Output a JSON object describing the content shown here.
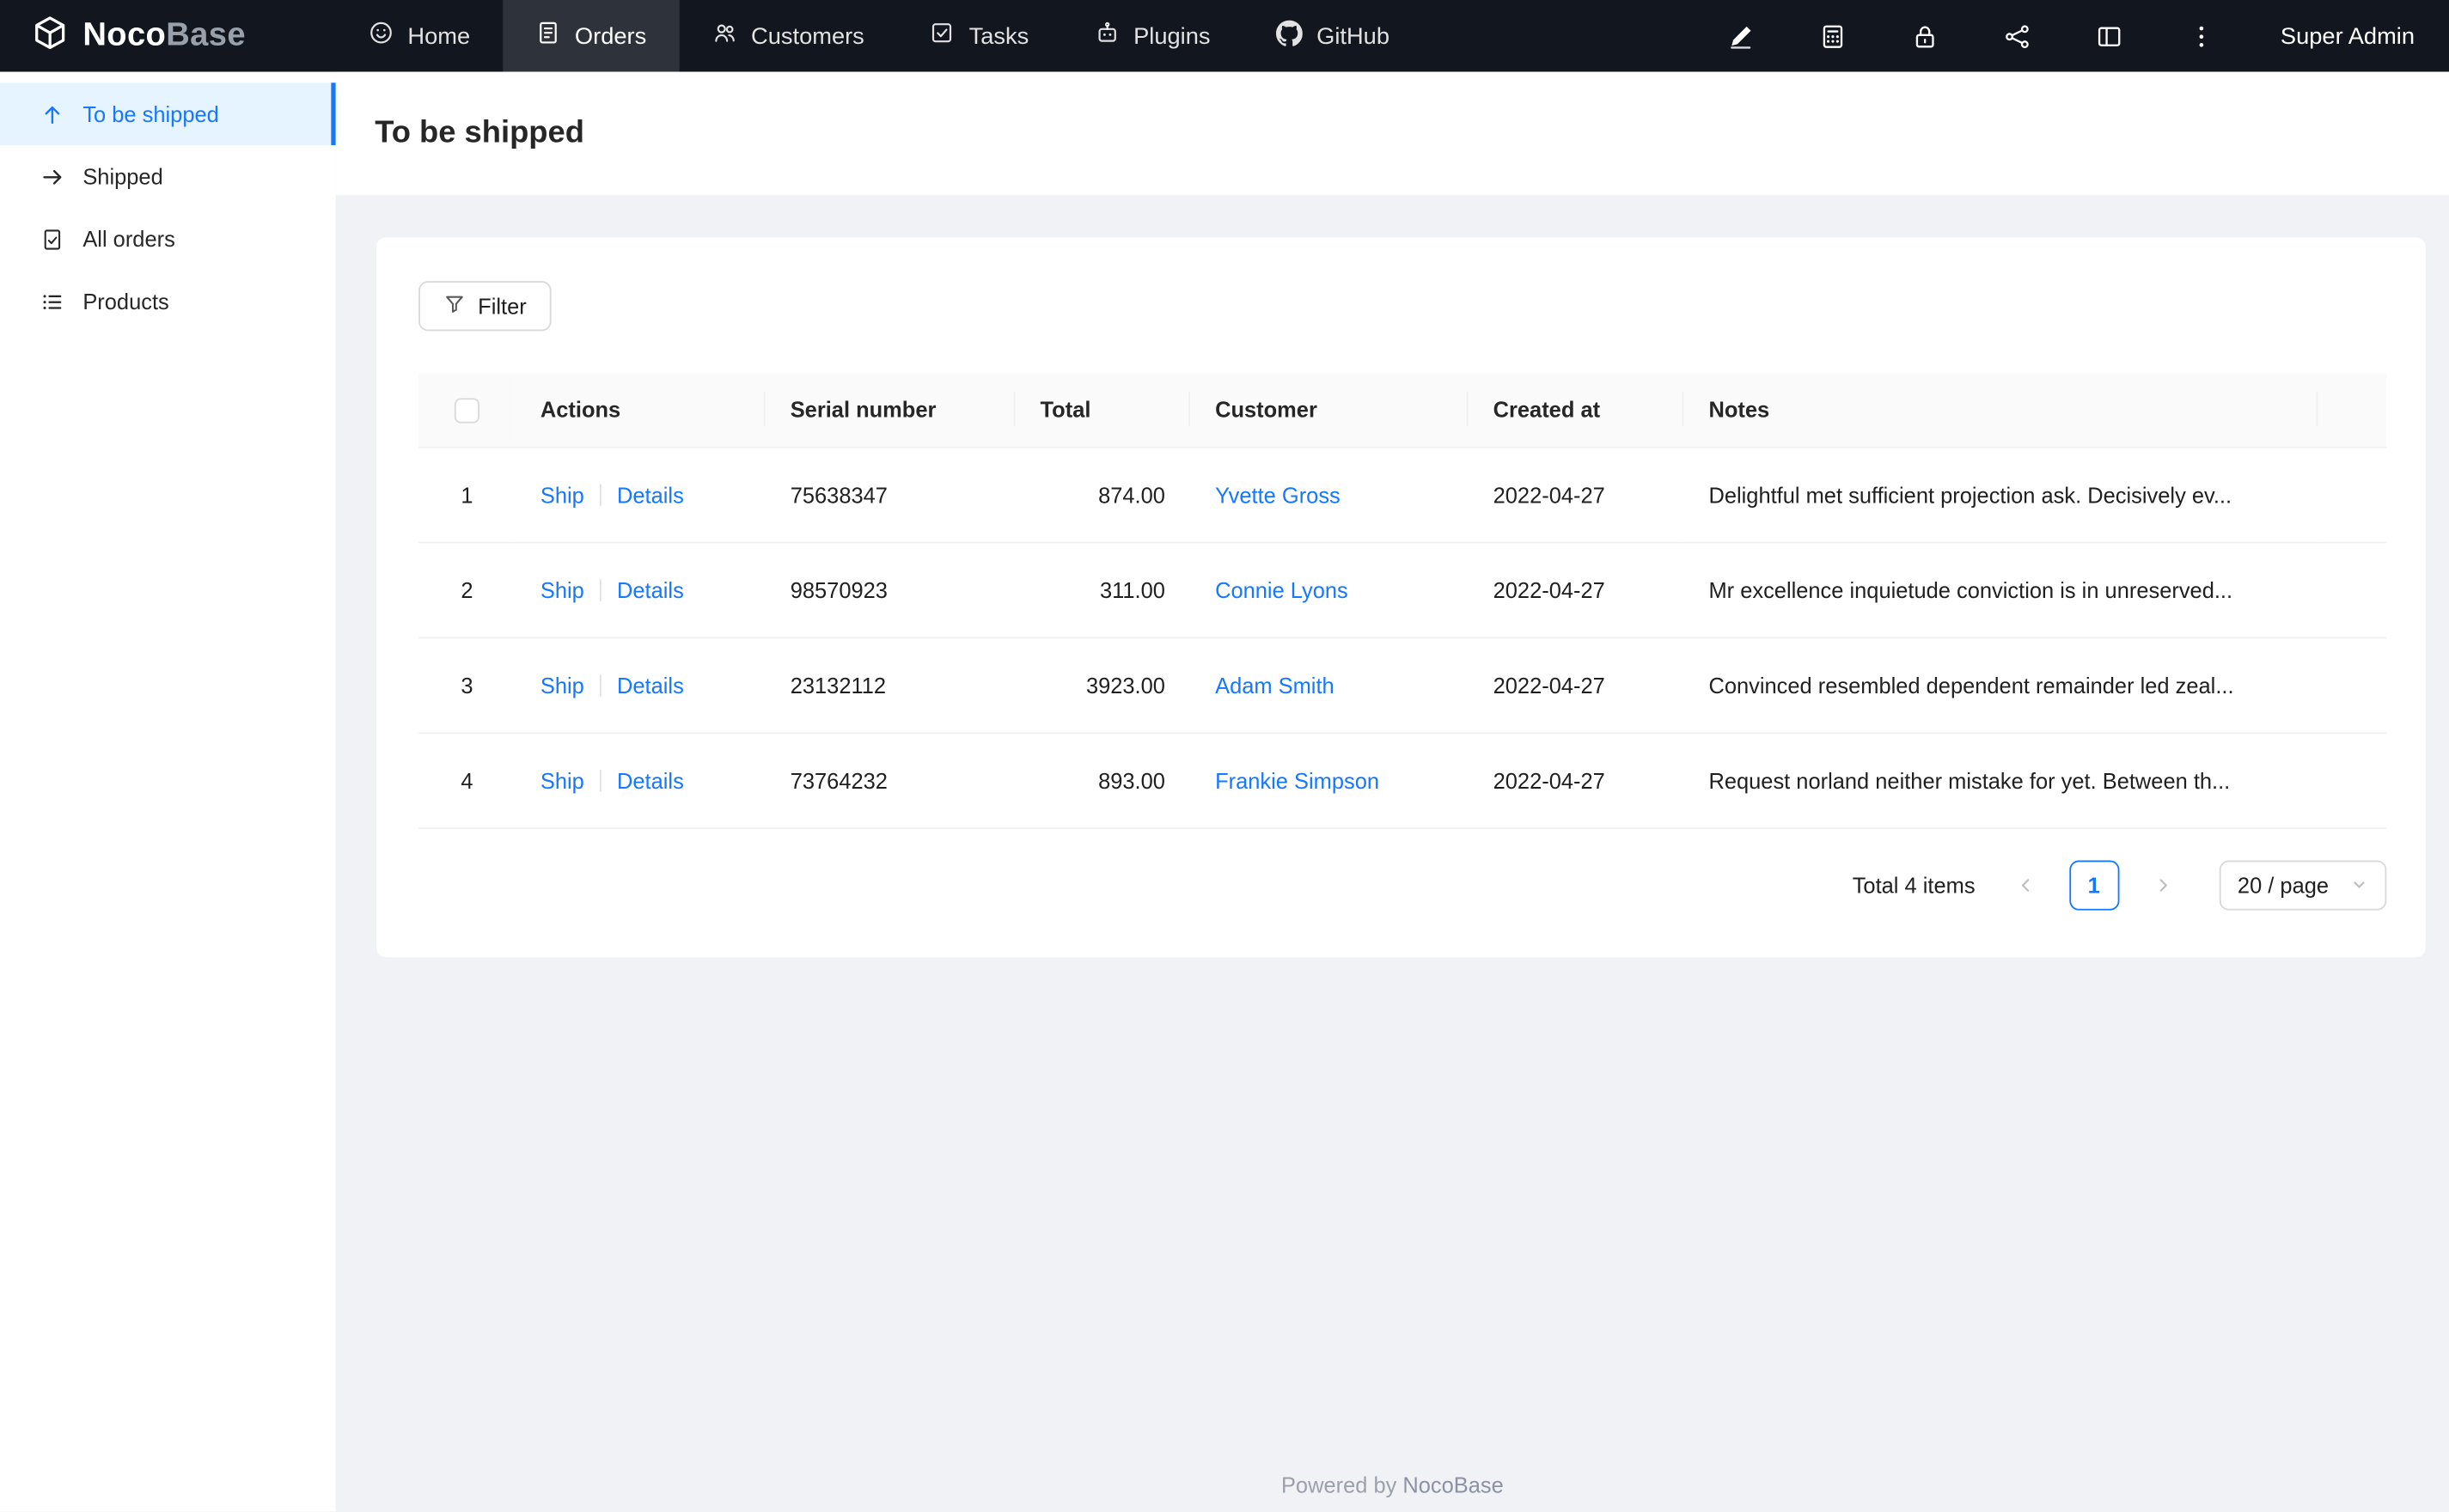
{
  "navbar": {
    "logo": {
      "brand_bold": "Noco",
      "brand_light": "Base"
    },
    "items": [
      {
        "label": "Home"
      },
      {
        "label": "Orders"
      },
      {
        "label": "Customers"
      },
      {
        "label": "Tasks"
      },
      {
        "label": "Plugins"
      },
      {
        "label": "GitHub"
      }
    ],
    "user": "Super Admin"
  },
  "sidebar": {
    "items": [
      {
        "label": "To be shipped"
      },
      {
        "label": "Shipped"
      },
      {
        "label": "All orders"
      },
      {
        "label": "Products"
      }
    ]
  },
  "page": {
    "title": "To be shipped"
  },
  "toolbar": {
    "filter_label": "Filter"
  },
  "table": {
    "columns": [
      "Actions",
      "Serial number",
      "Total",
      "Customer",
      "Created at",
      "Notes"
    ],
    "rows": [
      {
        "index": "1",
        "actions": [
          "Ship",
          "Details"
        ],
        "serial": "75638347",
        "total": "874.00",
        "customer": "Yvette Gross",
        "created_at": "2022-04-27",
        "notes": "Delightful met sufficient projection ask. Decisively ev..."
      },
      {
        "index": "2",
        "actions": [
          "Ship",
          "Details"
        ],
        "serial": "98570923",
        "total": "311.00",
        "customer": "Connie Lyons",
        "created_at": "2022-04-27",
        "notes": "Mr excellence inquietude conviction is in unreserved..."
      },
      {
        "index": "3",
        "actions": [
          "Ship",
          "Details"
        ],
        "serial": "23132112",
        "total": "3923.00",
        "customer": "Adam Smith",
        "created_at": "2022-04-27",
        "notes": "Convinced resembled dependent remainder led zeal..."
      },
      {
        "index": "4",
        "actions": [
          "Ship",
          "Details"
        ],
        "serial": "73764232",
        "total": "893.00",
        "customer": "Frankie Simpson",
        "created_at": "2022-04-27",
        "notes": "Request norland neither mistake for yet. Between th..."
      }
    ]
  },
  "pagination": {
    "total_text": "Total 4 items",
    "current_page": "1",
    "page_size": "20 / page"
  },
  "footer": {
    "powered_by": "Powered by ",
    "brand": "NocoBase"
  },
  "icons": [
    "nocobase-logo",
    "home-icon",
    "orders-icon",
    "customers-icon",
    "tasks-icon",
    "plugins-icon",
    "github-icon",
    "highlighter-icon",
    "collections-icon",
    "lock-icon",
    "api-icon",
    "layout-icon",
    "more-icon",
    "arrow-up-icon",
    "arrow-right-icon",
    "file-icon",
    "list-icon",
    "filter-icon",
    "chevron-left-icon",
    "chevron-right-icon",
    "chevron-down-icon"
  ],
  "colors": {
    "primary": "#1677ff",
    "navbar_bg": "#12161f",
    "sidebar_active_bg": "#e6f4ff",
    "content_bg": "#f0f2f5",
    "border": "#f0f0f0"
  }
}
